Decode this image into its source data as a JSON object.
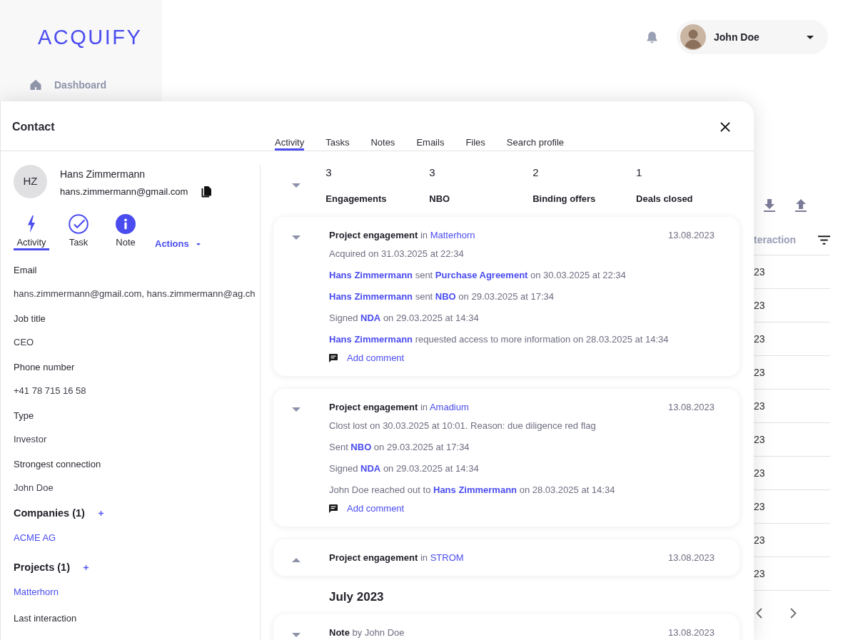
{
  "sidebar": {
    "logo": "ACQUIFY",
    "items": [
      {
        "label": "Dashboard",
        "selected": false
      }
    ]
  },
  "header": {
    "user": {
      "name": "John Doe"
    }
  },
  "table": {
    "column_header": "teraction",
    "cells": [
      "23",
      "23",
      "23",
      "23",
      "23",
      "23",
      "23",
      "23",
      "23",
      "23"
    ]
  },
  "contact": {
    "title": "Contact",
    "tabs": [
      {
        "label": "Activity",
        "selected": true
      },
      {
        "label": "Tasks",
        "selected": false
      },
      {
        "label": "Notes",
        "selected": false
      },
      {
        "label": "Emails",
        "selected": false
      },
      {
        "label": "Files",
        "selected": false
      },
      {
        "label": "Search profile",
        "selected": false
      }
    ],
    "profile": {
      "initials": "HZ",
      "name": "Hans Zimmermann",
      "email": "hans.zimmermann@gmail.com"
    },
    "quick_actions": [
      {
        "kind": "activity",
        "label": "Activity",
        "selected": true
      },
      {
        "kind": "task",
        "label": "Task",
        "selected": false
      },
      {
        "kind": "note",
        "label": "Note",
        "selected": false
      }
    ],
    "actions_menu": {
      "label": "Actions"
    },
    "fields": [
      {
        "label": "Email",
        "value": "hans.zimmermann@gmail.com, hans.zimmermann@ag.ch"
      },
      {
        "label": "Job title",
        "value": "CEO"
      },
      {
        "label": "Phone number",
        "value": "+41 78 715 16 58"
      },
      {
        "label": "Type",
        "value": "Investor"
      },
      {
        "label": "Strongest connection",
        "value": "John Doe"
      }
    ],
    "sections": [
      {
        "title": "Companies (1)",
        "items": [
          "ACME AG"
        ]
      },
      {
        "title": "Projects (1)",
        "items": [
          "Matterhorn"
        ]
      }
    ],
    "last_interaction": {
      "label": "Last interaction"
    }
  },
  "activity": {
    "stats": {
      "expanded": true,
      "items": [
        {
          "value": "3",
          "label": "Engagements"
        },
        {
          "value": "3",
          "label": "NBO"
        },
        {
          "value": "2",
          "label": "Binding offers"
        },
        {
          "value": "1",
          "label": "Deals closed"
        }
      ]
    },
    "feed": [
      {
        "kind": "card",
        "title": "Project engagement",
        "connector": "in",
        "link": "Matterhorn",
        "date": "13.08.2023",
        "expanded": true,
        "lines": [
          "Acquired on 31.03.2025 at 22:34",
          "**Hans Zimmermann** sent **Purchase Agreement** on 30.03.2025 at 22:34",
          "**Hans Zimmermann** sent **NBO** on 29.03.2025 at 17:34",
          "Signed **NDA** on 29.03.2025 at 14:34",
          "**Hans Zimmermann** requested access to more information on 28.03.2025 at 14:34"
        ],
        "comment_action": "Add comment"
      },
      {
        "kind": "card",
        "title": "Project engagement",
        "connector": "in",
        "link": "Amadium",
        "date": "13.08.2023",
        "expanded": true,
        "lines": [
          "Clost lost on 30.03.2025 at 10:01. Reason: due diligence red flag",
          "Sent **NBO** on 29.03.2025 at 17:34",
          "Signed **NDA** on 29.03.2025 at 14:34",
          "John Doe reached out to **Hans Zimmermann** on 28.03.2025 at 14:34"
        ],
        "comment_action": "Add comment"
      },
      {
        "kind": "card",
        "title": "Project engagement",
        "connector": "in",
        "link": "STROM",
        "date": "13.08.2023",
        "expanded": false
      },
      {
        "kind": "month",
        "label": "July 2023"
      },
      {
        "kind": "card",
        "title": "Note",
        "connector": "by John Doe",
        "date": "13.08.2023",
        "expanded": true
      }
    ]
  }
}
